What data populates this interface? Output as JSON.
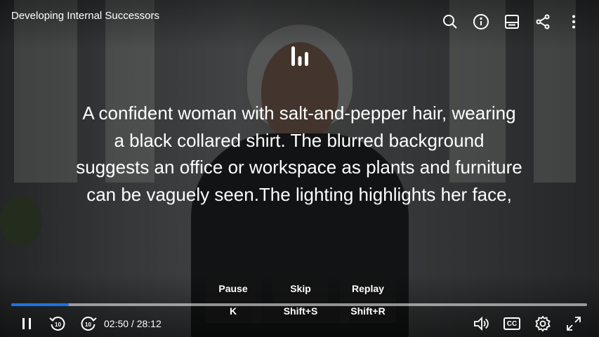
{
  "video": {
    "title": "Developing Internal Successors",
    "audio_description": "A confident woman with salt-and-pepper hair, wearing a black collared shirt. The blurred background suggests an office or workspace as plants and furniture can be vaguely seen.The lighting highlights her face,"
  },
  "top_bar": {
    "icons": [
      "search-icon",
      "info-icon",
      "transcript-icon",
      "share-icon",
      "more-options-icon"
    ]
  },
  "shortcuts": [
    {
      "label": "Pause",
      "key": "K"
    },
    {
      "label": "Skip",
      "key": "Shift+S"
    },
    {
      "label": "Replay",
      "key": "Shift+R"
    }
  ],
  "playback": {
    "current_time": "2:50",
    "duration": "28:12",
    "time_display": "02:50 / 28:12",
    "progress_percent": 10.05,
    "skip_seconds": "10"
  },
  "controls": {
    "captions_label": "CC"
  },
  "colors": {
    "progress_fill": "#1a73e8",
    "text": "#ffffff"
  }
}
